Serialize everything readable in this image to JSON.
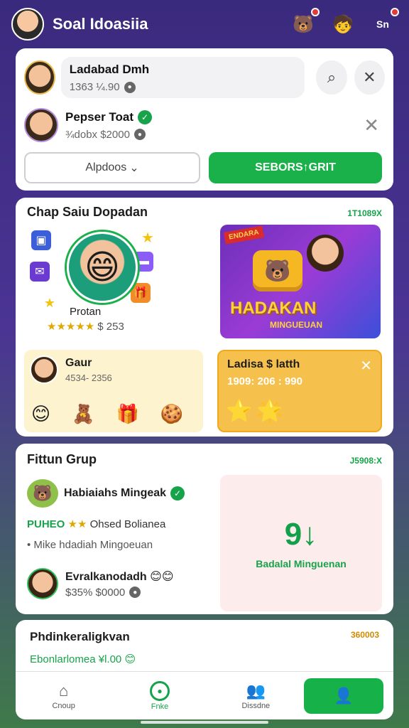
{
  "app": {
    "title": "Soal Idoasiia"
  },
  "top_icons": [
    "bear-emoji-icon",
    "kid-avatar-icon",
    "profile-badge-icon"
  ],
  "top_badge_text": "Sn",
  "panel1": {
    "search_card": {
      "name": "Ladabad Dmh",
      "sub": "1363 ¼.90"
    },
    "friend": {
      "name": "Pepser Toat",
      "sub": "¾dobx $2000"
    },
    "btn_outline": "Alpdoos",
    "btn_green": "SEBORS↑GRIT"
  },
  "panel2": {
    "title": "Chap Saiu Dopadan",
    "meta": "1T1089X",
    "profile_label": "Protan",
    "rating_value": "$ 253",
    "promo_ribbon": "ENDARA",
    "promo_title": "HADAKAN",
    "promo_sub": "MINGUEUAN",
    "card1": {
      "name": "Gaur",
      "sub": "4534- 2356"
    },
    "card2": {
      "name": "Ladisa $ latth",
      "sub": "1909: 206 : 990"
    }
  },
  "panel3": {
    "title": "Fittun Grup",
    "meta": "J5908:X",
    "feat_name": "Habiaiahs Mingeak",
    "line1_green": "PUHEO",
    "line1_rest": "Ohsed Bolianea",
    "line2": "• Mike hdadiah Mingoeuan",
    "user": {
      "name": "Evralkanodadh",
      "sub": "$35% $0000"
    },
    "pink_label": "Badalal Minguenan"
  },
  "panel4": {
    "title": "Phdinkeraligkvan",
    "sub": "Ebonlarlomea ¥l.00",
    "meta": "360003"
  },
  "nav": {
    "items": [
      {
        "label": "Cnoup",
        "icon": "home-icon"
      },
      {
        "label": "Fnke",
        "icon": "record-icon"
      },
      {
        "label": "Dissdne",
        "icon": "people-icon"
      }
    ]
  },
  "colors": {
    "accent": "#1bb14a",
    "bg_top": "#3a2a7d",
    "promo": "#6b2fb8"
  }
}
